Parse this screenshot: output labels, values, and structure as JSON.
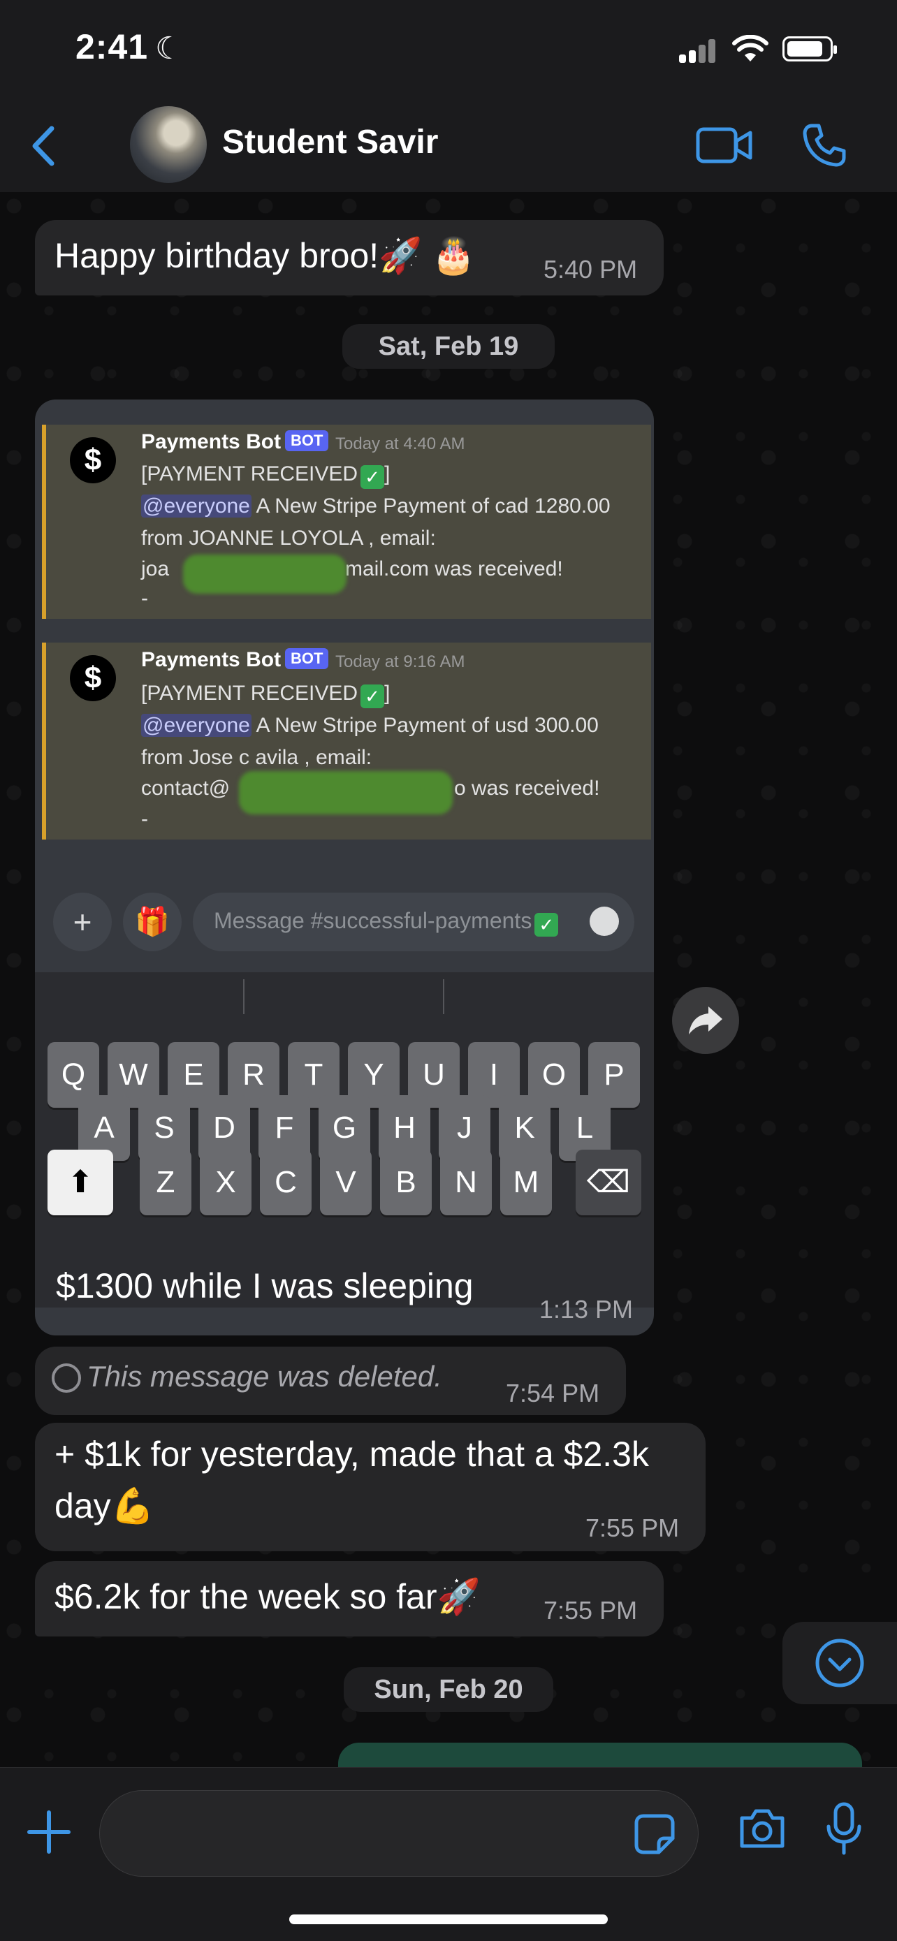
{
  "status_bar": {
    "time": "2:41"
  },
  "header": {
    "contact_name": "Student Savir"
  },
  "messages": {
    "birthday": {
      "text": "Happy birthday broo!🚀 🎂",
      "time": "5:40 PM"
    },
    "date_sat": "Sat, Feb 19",
    "screenshot": {
      "embeds": [
        {
          "author": "Payments Bot",
          "badge": "BOT",
          "timestamp": "Today at 4:40 AM",
          "title": "[PAYMENT RECEIVED",
          "mention": "@everyone",
          "line1_rest": " A New Stripe Payment of cad 1280.00",
          "line2": "from JOANNE LOYOLA , email:",
          "line3_start": "joa",
          "line3_end": "mail.com was received!",
          "line4": "-"
        },
        {
          "author": "Payments Bot",
          "badge": "BOT",
          "timestamp": "Today at 9:16 AM",
          "title": "[PAYMENT RECEIVED",
          "mention": "@everyone",
          "line1_rest": " A New Stripe Payment of usd 300.00",
          "line2": "from Jose c avila , email:",
          "line3_start": "contact@",
          "line3_end": "o was received!",
          "line4": "-"
        }
      ],
      "input_placeholder": "Message #successful-payments",
      "keyboard": {
        "row1": [
          "Q",
          "W",
          "E",
          "R",
          "T",
          "Y",
          "U",
          "I",
          "O",
          "P"
        ],
        "row2": [
          "A",
          "S",
          "D",
          "F",
          "G",
          "H",
          "J",
          "K",
          "L"
        ],
        "row3": [
          "Z",
          "X",
          "C",
          "V",
          "B",
          "N",
          "M"
        ]
      },
      "caption": "$1300 while I was sleeping",
      "time": "1:13 PM"
    },
    "deleted": {
      "text": "This message was deleted.",
      "time": "7:54 PM"
    },
    "yesterday": {
      "line1": "+ $1k for yesterday, made that a $2.3k",
      "line2": "day💪",
      "time": "7:55 PM"
    },
    "week": {
      "text": "$6.2k for the week so far🚀",
      "time": "7:55 PM"
    },
    "date_sun": "Sun, Feb 20"
  },
  "colors": {
    "accent": "#3e96e6",
    "bubble": "#262628",
    "outgoing": "#1d4a3c",
    "discord_blurple": "#5865f2",
    "embed_border": "#d8a12b"
  },
  "icons": [
    "back-icon",
    "video-call-icon",
    "phone-icon",
    "forward-icon",
    "chevron-down-icon",
    "plus-icon",
    "sticker-icon",
    "camera-icon",
    "microphone-icon",
    "gift-icon",
    "emoji-icon",
    "shift-icon",
    "backspace-icon"
  ]
}
